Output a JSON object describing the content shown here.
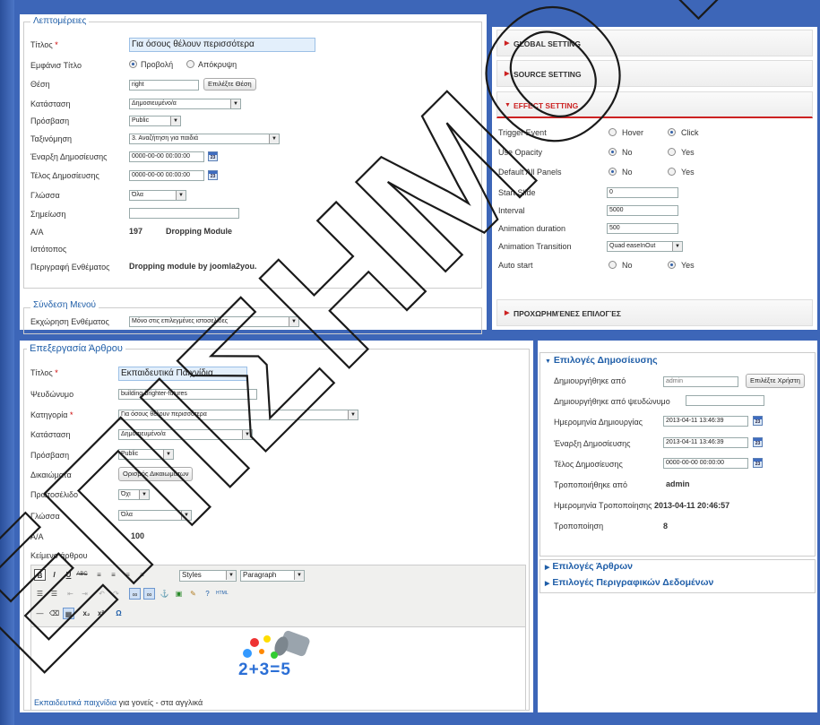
{
  "module": {
    "details_legend": "Λεπτομέρειες",
    "title_label": "Τίτλος",
    "required_star": "*",
    "title_value": "Για όσους θέλουν περισσότερα",
    "show_title_label": "Εμφάνισ Τίτλο",
    "show_label": "Προβολή",
    "hide_label": "Απόκρυψη",
    "position_label": "Θέση",
    "position_value": "right",
    "select_position_button": "Επιλέξτε Θέση",
    "status_label": "Κατάσταση",
    "status_value": "Δημοσιευμένο/α",
    "access_label": "Πρόσβαση",
    "access_value": "Public",
    "ordering_label": "Ταξινόμηση",
    "ordering_value": "3. Αναζήτηση για παιδιά",
    "publish_up_label": "Έναρξη Δημοσίευσης",
    "publish_up_value": "0000-00-00 00:00:00",
    "publish_down_label": "Τέλος Δημοσίευσης",
    "publish_down_value": "0000-00-00 00:00:00",
    "language_label": "Γλώσσα",
    "language_value": "Όλα",
    "note_label": "Σημείωση",
    "id_label": "Α/Α",
    "id_value": "197",
    "module_type": "Dropping Module",
    "site_label": "Ιστότοπος",
    "desc_label": "Περιγραφή Ενθέματος",
    "desc_value": "Dropping module by joomla2you.",
    "menu_legend": "Σύνδεση Μενού",
    "menu_assign_label": "Εκχώρηση Ενθέματος",
    "menu_assign_value": "Μόνο στις επιλεγμένες ιστοσελίδες",
    "calendar_glyph": "23"
  },
  "settings": {
    "global": "GLOBAL SETTING",
    "source": "SOURCE SETTING",
    "effect": "EFFECT SETTING",
    "trigger_label": "Trigger Event",
    "hover": "Hover",
    "click": "Click",
    "opacity_label": "Use Opacity",
    "no": "No",
    "yes": "Yes",
    "default_panels_label": "Default All Panels",
    "start_slide_label": "Start Slide",
    "start_slide_value": "0",
    "interval_label": "Interval",
    "interval_value": "5000",
    "anim_duration_label": "Animation duration",
    "anim_duration_value": "500",
    "anim_transition_label": "Animation Transition",
    "anim_transition_value": "Quad easeInOut",
    "auto_start_label": "Auto start",
    "advanced": "ΠΡΟΧΩΡΗΜΈΝΕΣ ΕΠΙΛΟΓΈΣ"
  },
  "article": {
    "legend": "Επεξεργασία Άρθρου",
    "title_label": "Τίτλος",
    "title_value": "Εκπαιδευτικά Παιχνίδια",
    "alias_label": "Ψευδώνυμο",
    "alias_value": "building-brighter-futures",
    "category_label": "Κατηγορία",
    "category_value": "Για όσους θέλουν περισσότερα",
    "status_label": "Κατάσταση",
    "status_value": "Δημοσιευμένο/α",
    "access_label": "Πρόσβαση",
    "access_value": "Public",
    "permissions_label": "Δικαιώματα",
    "permissions_button": "Ορισμός Δικαιωμάτων",
    "featured_label": "Πρωτοσέλιδο",
    "featured_value": "Όχι",
    "language_label": "Γλώσσα",
    "language_value": "Όλα",
    "id_label": "Α/Α",
    "id_value": "100",
    "text_label": "Κείμενο άρθρου",
    "styles_value": "Styles",
    "paragraph_value": "Paragraph",
    "body_link": "Εκπαιδευτικά παιχνίδια",
    "body_text": " για γονείς - στα αγγλικά",
    "image_caption": "2+3=5"
  },
  "publishing": {
    "header": "Επιλογές Δημοσίευσης",
    "created_by_label": "Δημιουργήθηκε από",
    "created_by_value": "admin",
    "select_user_button": "Επιλέξτε Χρήστη",
    "created_alias_label": "Δημιουργήθηκε από ψευδώνυμο",
    "created_date_label": "Ημερομηνία Δημιουργίας",
    "created_date_value": "2013-04-11 13:46:39",
    "publish_up_label": "Έναρξη Δημοσίευσης",
    "publish_up_value": "2013-04-11 13:46:39",
    "publish_down_label": "Τέλος Δημοσίευσης",
    "publish_down_value": "0000-00-00 00:00:00",
    "modified_by_label": "Τροποποιήθηκε από",
    "modified_by_value": "admin",
    "modified_date_label": "Ημερομηνία Τροποποίησης",
    "modified_date_value": "2013-04-11 20:46:57",
    "revision_label": "Τροποποίηση",
    "revision_value": "8",
    "article_options": "Επιλογές Άρθρων",
    "metadata_options": "Επιλογές Περιγραφικών Δεδομένων"
  },
  "watermark": "ΕΠΙΣΗΜΟ ΠΕΙ"
}
